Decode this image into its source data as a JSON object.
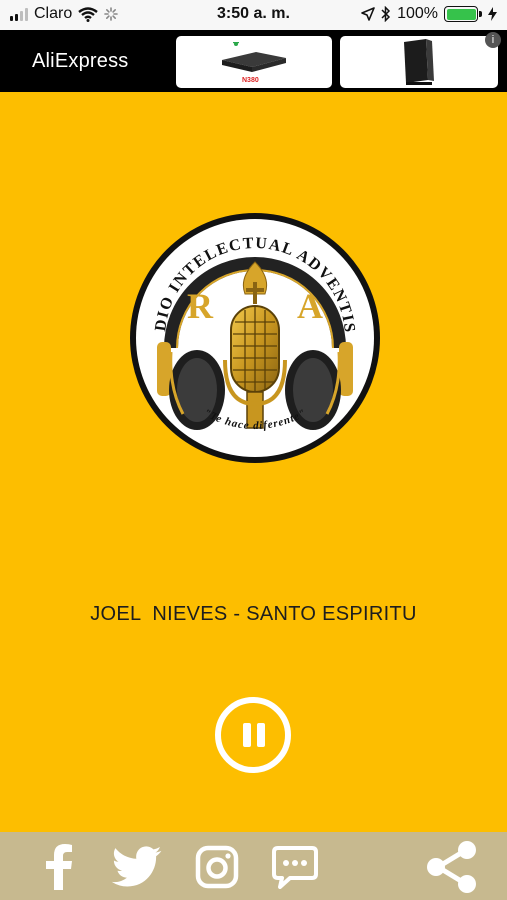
{
  "status_bar": {
    "carrier": "Claro",
    "time": "3:50 a. m.",
    "battery": "100%",
    "icons": [
      "signal-icon",
      "wifi-icon",
      "loading-icon",
      "location-icon",
      "bluetooth-icon",
      "battery-icon",
      "charging-icon"
    ]
  },
  "ad": {
    "brand": "AliExpress",
    "info_symbol": "i",
    "product_label": "N380"
  },
  "logo": {
    "top_text": "RADIO INTELECTUAL ADVENTISTA",
    "letters_left": "R",
    "letters_right": "A",
    "tagline": "\"Te hace diferente\""
  },
  "player": {
    "now_playing": "JOEL  NIEVES - SANTO ESPIRITU",
    "state_icon": "pause-icon"
  },
  "social": {
    "icons": [
      "facebook-icon",
      "twitter-icon",
      "instagram-icon",
      "chat-icon",
      "share-icon"
    ]
  },
  "colors": {
    "background": "#fdbe00",
    "bottom_bar": "#c7b98f",
    "gold": "#d7a52a"
  }
}
